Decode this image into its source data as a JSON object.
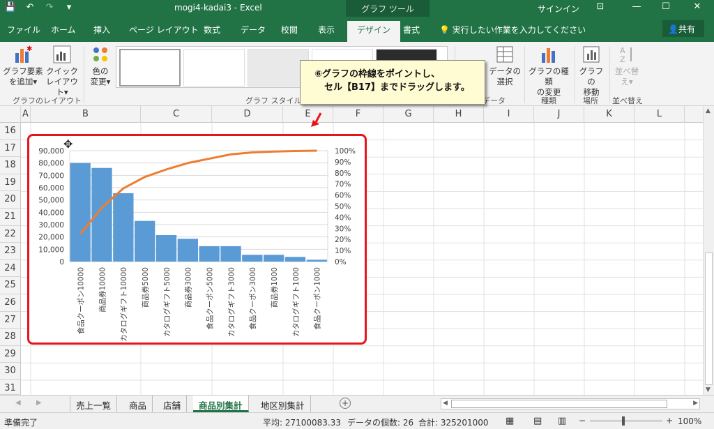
{
  "window": {
    "title": "mogi4-kadai3  -  Excel",
    "contextual_tool": "グラフ ツール",
    "signin": "サインイン"
  },
  "tabs": [
    "ファイル",
    "ホーム",
    "挿入",
    "ページ レイアウト",
    "数式",
    "データ",
    "校閲",
    "表示",
    "デザイン",
    "書式"
  ],
  "tell_me": "実行したい作業を入力してください",
  "share": "共有",
  "ribbon": {
    "add_element": [
      "グラフ要素",
      "を追加"
    ],
    "quick_layout": [
      "クイック",
      "レイアウト"
    ],
    "change_color": [
      "色の",
      "変更"
    ],
    "group_layout": "グラフのレイアウト",
    "group_styles": "グラフ スタイル",
    "select_data": [
      "データの",
      "選択"
    ],
    "group_data": "データ",
    "change_type": [
      "グラフの種類",
      "の変更"
    ],
    "group_type": "種類",
    "move_chart": [
      "グラフの",
      "移動"
    ],
    "group_location": "場所",
    "sort": [
      "並べ替",
      "え"
    ],
    "group_sort": "並べ替え"
  },
  "callout": {
    "line1": "⑥グラフの枠線をポイントし、",
    "line2": "セル【B17】までドラッグします。"
  },
  "columns": [
    "A",
    "B",
    "C",
    "D",
    "E",
    "F",
    "G",
    "H",
    "I",
    "J",
    "K",
    "L"
  ],
  "rows": [
    "16",
    "17",
    "18",
    "19",
    "20",
    "21",
    "22",
    "23",
    "24",
    "25",
    "26",
    "27",
    "28",
    "29",
    "30",
    "31"
  ],
  "sheets": [
    "売上一覧",
    "商品",
    "店舗",
    "商品別集計",
    "地区別集計"
  ],
  "active_sheet": "商品別集計",
  "status": {
    "ready": "準備完了",
    "average": "平均: 27100083.33",
    "count": "データの個数: 26",
    "sum": "合計: 325201000",
    "zoom": "100%"
  },
  "colors": {
    "excel_green": "#217346",
    "bar": "#5b9bd5",
    "line": "#ed7d31",
    "highlight": "#e8141c"
  },
  "chart_data": {
    "type": "bar",
    "categories": [
      "食品クーポン10000",
      "商品券10000",
      "カタログギフト10000",
      "商品券5000",
      "カタログギフト5000",
      "商品券3000",
      "食品クーポン5000",
      "カタログギフト3000",
      "食品クーポン3000",
      "商品券1000",
      "カタログギフト1000",
      "食品クーポン1000"
    ],
    "series": [
      {
        "values": [
          80000,
          76000,
          55500,
          33000,
          21500,
          18500,
          12500,
          12500,
          5500,
          5500,
          3800,
          1500
        ],
        "axis": "left"
      },
      {
        "type": "line",
        "values": [
          25.0,
          48.8,
          66.1,
          76.4,
          83.1,
          88.9,
          92.8,
          96.7,
          98.4,
          99.2,
          99.7,
          100.0
        ],
        "axis": "right"
      }
    ],
    "y_left_ticks": [
      "0",
      "10,000",
      "20,000",
      "30,000",
      "40,000",
      "50,000",
      "60,000",
      "70,000",
      "80,000",
      "90,000"
    ],
    "y_right_ticks": [
      "0%",
      "10%",
      "20%",
      "30%",
      "40%",
      "50%",
      "60%",
      "70%",
      "80%",
      "90%",
      "100%"
    ],
    "ylim_left": [
      0,
      90000
    ],
    "ylim_right": [
      0,
      100
    ],
    "grid": true
  }
}
